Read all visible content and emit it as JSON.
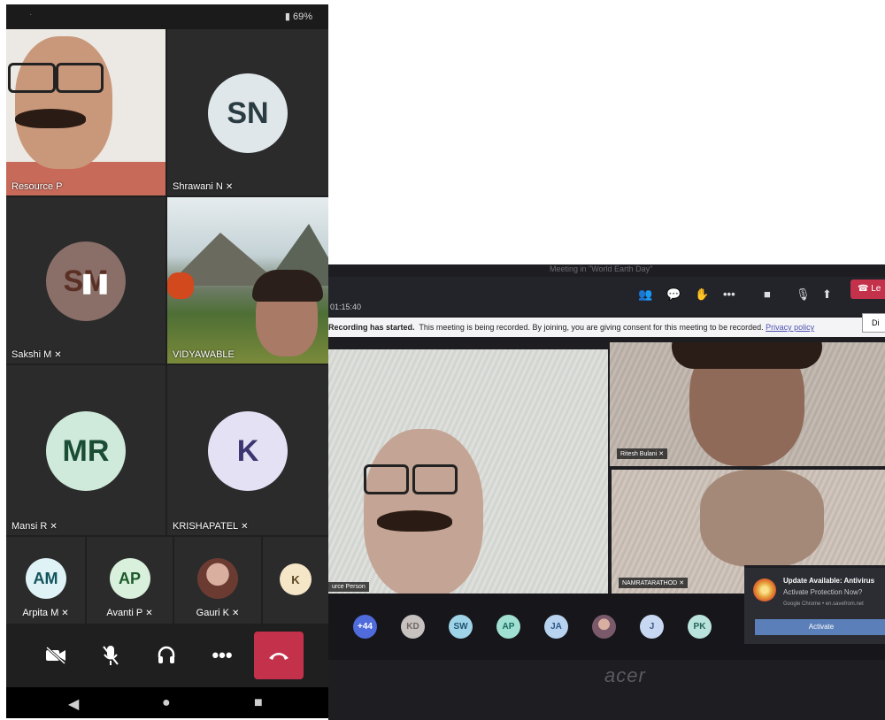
{
  "phone": {
    "status": {
      "battery": "69%"
    },
    "tiles": [
      {
        "name": "Resource P",
        "muted": false,
        "type": "video"
      },
      {
        "name": "Shrawani N",
        "initials": "SN",
        "muted": true,
        "avatar_color": "#dfe7ea",
        "text_color": "#2a3b42"
      },
      {
        "name": "Sakshi M",
        "initials": "SM",
        "muted": true,
        "avatar_color": "#8a6e68",
        "text_color": "#5a2f24"
      },
      {
        "name": "VIDYAWABLE",
        "muted": false,
        "type": "video"
      },
      {
        "name": "Mansi R",
        "initials": "MR",
        "muted": true,
        "avatar_color": "#cfeadb",
        "text_color": "#1b4d35"
      },
      {
        "name": "KRISHAPATEL",
        "initials": "K",
        "muted": true,
        "avatar_color": "#e4e1f5",
        "text_color": "#3c3670"
      }
    ],
    "small_tiles": [
      {
        "name": "Arpita M",
        "initials": "AM",
        "muted": true,
        "avatar_color": "#dff3f6",
        "text_color": "#12525c"
      },
      {
        "name": "Avanti P",
        "initials": "AP",
        "muted": true,
        "avatar_color": "#d8f0dc",
        "text_color": "#1c5a2b"
      },
      {
        "name": "Gauri K",
        "initials": "",
        "muted": true,
        "avatar_color": "#b07a6a",
        "text_color": "#ffffff"
      },
      {
        "name": "",
        "initials": "K",
        "muted": false,
        "avatar_color": "#f6e6c8",
        "text_color": "#5a4520"
      }
    ],
    "controls": [
      "camera-off-icon",
      "mic-off-icon",
      "headset-icon",
      "more-icon",
      "hang-up-icon"
    ],
    "nav": [
      "back",
      "home",
      "recents"
    ]
  },
  "laptop": {
    "window_title": "Meeting in \"World Earth Day\"",
    "timer": "01:15:40",
    "leave_label": "Le",
    "recording": {
      "bold": "Recording has started.",
      "text": "This meeting is being recorded. By joining, you are giving consent for this meeting to be recorded.",
      "link": "Privacy policy",
      "dismiss": "Di"
    },
    "videos": [
      {
        "name": "urce Person"
      },
      {
        "name": "Ritesh Bulani"
      },
      {
        "name": "NAMRATARATHOD"
      }
    ],
    "bottom_avatars": [
      {
        "label": "+44",
        "color": "#4f6bdc",
        "text": "#ffffff"
      },
      {
        "label": "KD",
        "color": "#c7c2c0",
        "text": "#6e6560"
      },
      {
        "label": "SW",
        "color": "#9fd3e8",
        "text": "#1f5570"
      },
      {
        "label": "AP",
        "color": "#9fe0d3",
        "text": "#1a6a5a"
      },
      {
        "label": "JA",
        "color": "#b7d3ef",
        "text": "#2f5a88"
      },
      {
        "label": "",
        "color": "#8a6a7a",
        "text": "#ffffff"
      },
      {
        "label": "J",
        "color": "#c9d8f2",
        "text": "#3b5683"
      },
      {
        "label": "PK",
        "color": "#b9e3dc",
        "text": "#286457"
      }
    ],
    "brand": "acer",
    "popup": {
      "title": "Update Available: Antivirus",
      "subtitle": "Activate Protection Now?",
      "source": "Google Chrome • en.savefrom.net",
      "button": "Activate"
    }
  }
}
